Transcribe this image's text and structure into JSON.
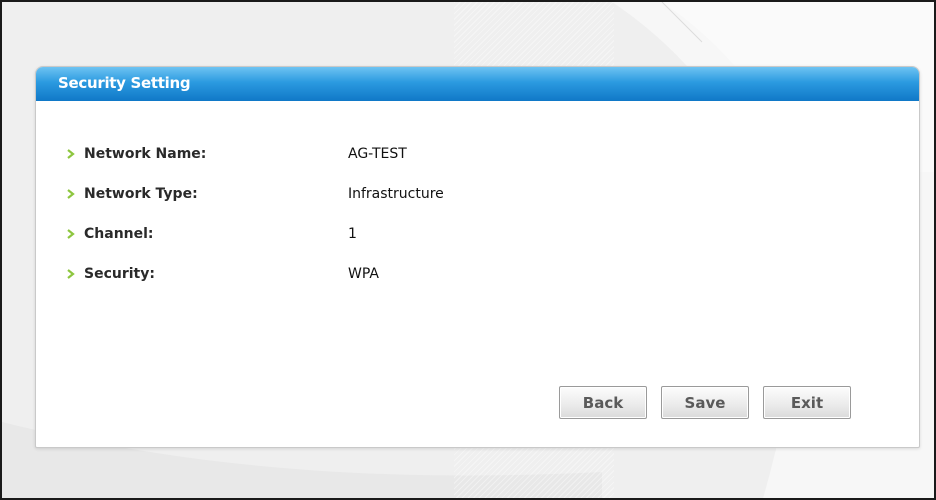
{
  "panel": {
    "title": "Security Setting"
  },
  "fields": [
    {
      "label": "Network Name:",
      "value": "AG-TEST"
    },
    {
      "label": "Network Type:",
      "value": "Infrastructure"
    },
    {
      "label": "Channel:",
      "value": "1"
    },
    {
      "label": "Security:",
      "value": "WPA"
    }
  ],
  "buttons": {
    "back": "Back",
    "save": "Save",
    "exit": "Exit"
  },
  "colors": {
    "header_top": "#6ec3f2",
    "header_bottom": "#1078c7",
    "bullet": "#8dc63f",
    "background": "#f1f1f1"
  },
  "icons": {
    "bullet": "chevron-right-icon"
  }
}
